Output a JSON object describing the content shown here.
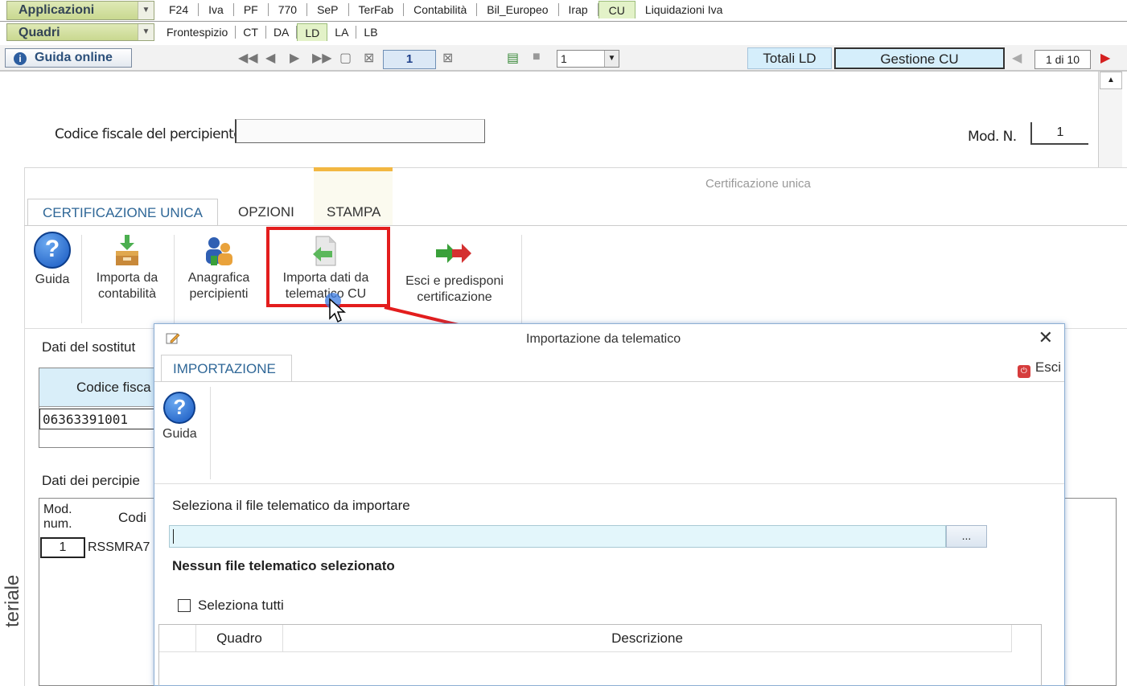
{
  "top_menu": {
    "applicazioni_label": "Applicazioni",
    "quadri_label": "Quadri",
    "apps": [
      "F24",
      "Iva",
      "PF",
      "770",
      "SeP",
      "TerFab",
      "Contabilità",
      "Bil_Europeo",
      "Irap",
      "CU",
      "Liquidazioni Iva"
    ],
    "active_app": "CU",
    "quadri": [
      "Frontespizio",
      "CT",
      "DA",
      "LD",
      "LA",
      "LB"
    ],
    "active_quadro": "LD"
  },
  "toolbar": {
    "guida_label": "Guida online",
    "page_value": "1",
    "select_value": "1",
    "totali_label": "Totali LD",
    "gestione_label": "Gestione CU",
    "page_of": "1 di 10"
  },
  "header": {
    "cf_label": "Codice fiscale del percipiente",
    "cf_value": "",
    "mod_label": "Mod. N.",
    "mod_value": "1"
  },
  "ribbon": {
    "panel_title": "Certificazione unica",
    "tabs": [
      "CERTIFICAZIONE UNICA",
      "OPZIONI",
      "STAMPA"
    ],
    "buttons": {
      "guida": "Guida",
      "importa_contab_1": "Importa da",
      "importa_contab_2": "contabilità",
      "anagrafica_1": "Anagrafica",
      "anagrafica_2": "percipienti",
      "importa_tel_1": "Importa dati da",
      "importa_tel_2": "telematico CU",
      "esci_1": "Esci e predisponi",
      "esci_2": "certificazione"
    }
  },
  "background": {
    "sostituto_label": "Dati del sostitut",
    "codice_fiscale_header": "Codice fisca",
    "codice_fiscale_value": "06363391001",
    "percipienti_label": "Dati dei percipie",
    "mod_num_1": "Mod.",
    "mod_num_2": "num.",
    "codi_header": "Codi",
    "row_mod": "1",
    "row_cf": "RSSMRA7",
    "side_text": "teriale"
  },
  "dialog": {
    "title": "Importazione da telematico",
    "tab": "IMPORTAZIONE",
    "esci": "Esci",
    "guida": "Guida",
    "select_file_label": "Seleziona il file telematico da importare",
    "file_value": "",
    "browse": "...",
    "status": "Nessun file telematico selezionato",
    "select_all": "Seleziona tutti",
    "columns": [
      "Quadro",
      "Descrizione"
    ]
  },
  "colors": {
    "highlight": "#e31d1d",
    "accent_blue": "#2f6797",
    "stampa_bar": "#f2b742"
  }
}
